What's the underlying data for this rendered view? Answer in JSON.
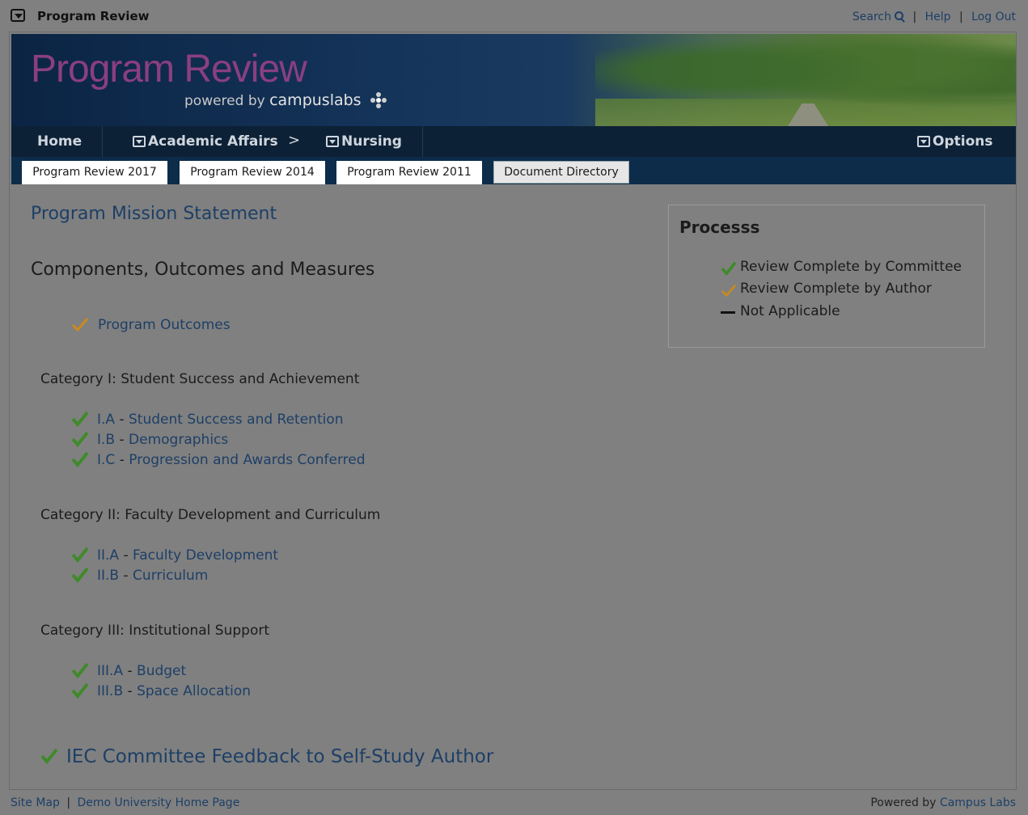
{
  "app": {
    "title": "Program Review"
  },
  "toplinks": {
    "search": "Search",
    "help": "Help",
    "logout": "Log Out",
    "sep": "|"
  },
  "banner": {
    "title": "Program Review",
    "powered": "powered by",
    "brand": "campuslabs"
  },
  "nav": {
    "home": "Home",
    "academic": "Academic Affairs",
    "chevron": ">",
    "nursing": "Nursing",
    "options": "Options"
  },
  "tabs": [
    "Program Review 2017",
    "Program Review 2014",
    "Program Review 2011",
    "Document Directory"
  ],
  "main": {
    "mission": "Program Mission Statement",
    "components": "Components, Outcomes and Measures",
    "program_outcomes": "Program Outcomes",
    "categories": [
      {
        "title": "Category I: Student Success and Achievement",
        "items": [
          {
            "code": "I.A",
            "label": "Student Success and Retention"
          },
          {
            "code": "I.B",
            "label": "Demographics"
          },
          {
            "code": "I.C",
            "label": "Progression and Awards Conferred"
          }
        ]
      },
      {
        "title": "Category II: Faculty Development and Curriculum",
        "items": [
          {
            "code": "II.A",
            "label": "Faculty Development"
          },
          {
            "code": "II.B",
            "label": "Curriculum"
          }
        ]
      },
      {
        "title": "Category III: Institutional Support",
        "items": [
          {
            "code": "III.A",
            "label": "Budget"
          },
          {
            "code": "III.B",
            "label": "Space Allocation"
          }
        ]
      }
    ],
    "dash": " - ",
    "feedback": "IEC Committee Feedback to Self-Study Author"
  },
  "legend": {
    "title": "Processs",
    "rows": [
      "Review Complete by Committee",
      "Review Complete by Author",
      "Not Applicable"
    ]
  },
  "footer": {
    "sitemap": "Site Map",
    "sep": "|",
    "home": "Demo University Home Page",
    "powered": "Powered by",
    "company": "Campus Labs"
  },
  "colors": {
    "check_green": "#3f8a2a",
    "check_orange": "#c98a1e",
    "link": "#1d3f66",
    "nav": "#0d2136"
  }
}
